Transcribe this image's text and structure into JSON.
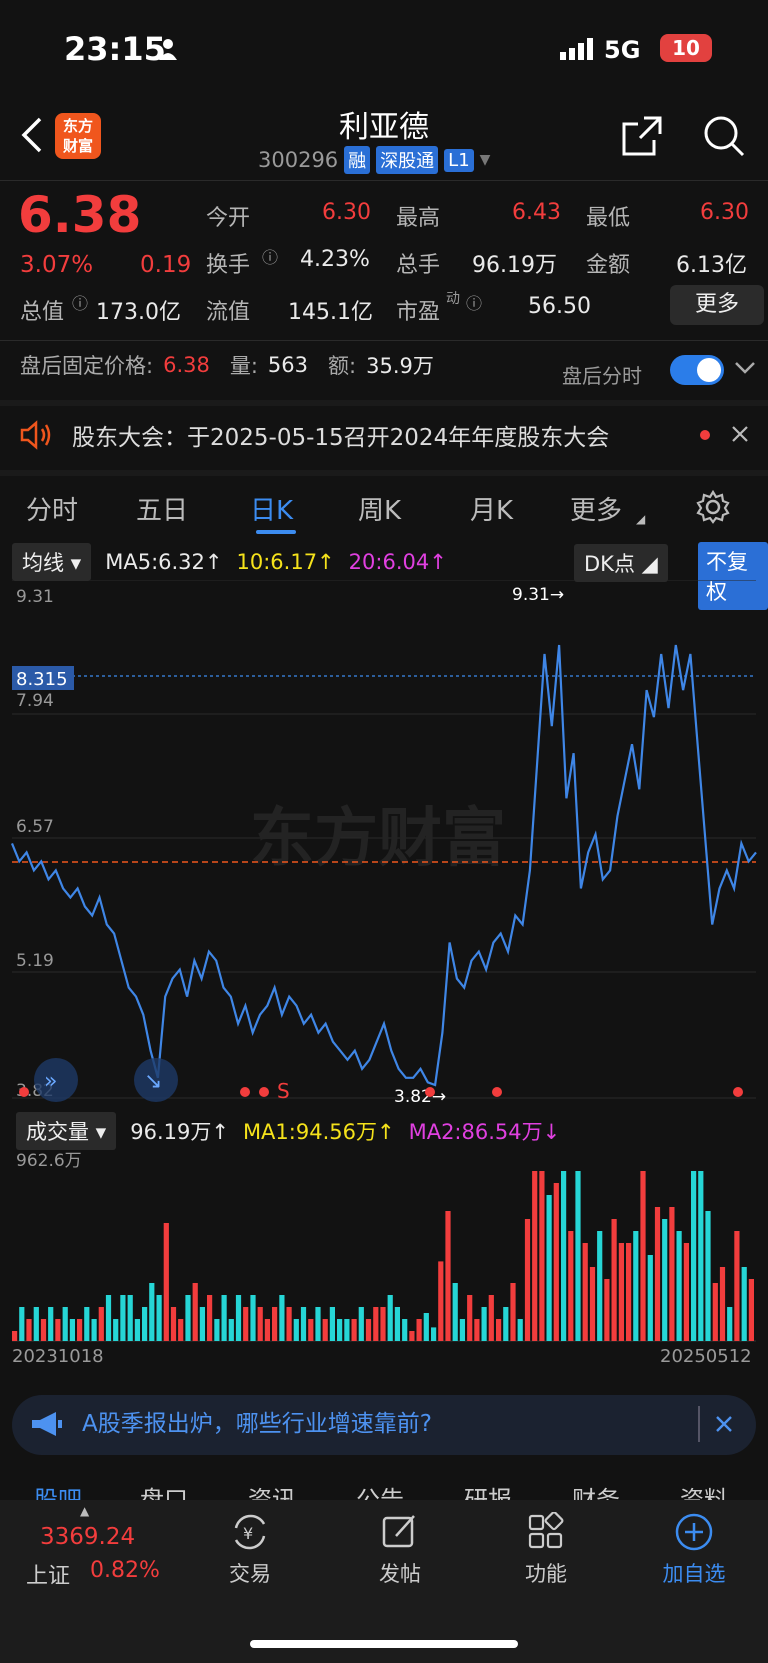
{
  "status_bar": {
    "time": "23:15",
    "network": "5G",
    "battery": "10"
  },
  "header": {
    "logo_line1": "东方",
    "logo_line2": "财富",
    "title": "利亚德",
    "code": "300296",
    "tags": [
      "融",
      "深股通",
      "L1"
    ]
  },
  "quote": {
    "price": "6.38",
    "change_pct": "3.07%",
    "change": "0.19",
    "open_label": "今开",
    "open": "6.30",
    "high_label": "最高",
    "high": "6.43",
    "low_label": "最低",
    "low": "6.30",
    "turnover_label": "换手",
    "turnover": "4.23%",
    "volume_label": "总手",
    "volume": "96.19万",
    "amount_label": "金额",
    "amount": "6.13亿",
    "mktcap_label": "总值",
    "mktcap": "173.0亿",
    "float_label": "流值",
    "float": "145.1亿",
    "pe_label": "市盈",
    "pe_sup": "动",
    "pe": "56.50",
    "more": "更多"
  },
  "afterhours": {
    "label": "盘后固定价格:",
    "price": "6.38",
    "vol_label": "量:",
    "vol": "563",
    "amt_label": "额:",
    "amt": "35.9万",
    "toggle_label": "盘后分时"
  },
  "notice": {
    "text": "股东大会：于2025-05-15召开2024年年度股东大会"
  },
  "tabs": [
    "分时",
    "五日",
    "日K",
    "周K",
    "月K",
    "更多"
  ],
  "active_tab": "日K",
  "chart": {
    "ma_select": "均线",
    "ma5": "MA5:6.32↑",
    "ma10": "10:6.17↑",
    "ma20": "20:6.04↑",
    "dk": "DK点",
    "adjust": "不复权",
    "y_labels": [
      "9.31",
      "7.94",
      "6.57",
      "5.19",
      "3.82"
    ],
    "crosshair_price": "8.315",
    "max_label": "9.31→",
    "min_label": "3.82→",
    "signal_label": "S",
    "watermark": "东方财富",
    "vol_select": "成交量",
    "vol_value": "96.19万↑",
    "vol_ma1": "MA1:94.56万↑",
    "vol_ma2": "MA2:86.54万↓",
    "vol_max": "962.6万",
    "date_start": "20231018",
    "date_end": "20250512"
  },
  "chart_data": {
    "type": "line",
    "ylim": [
      3.82,
      9.31
    ],
    "values": [
      6.5,
      6.3,
      6.4,
      6.2,
      6.3,
      6.1,
      6.2,
      6.0,
      5.9,
      6.0,
      5.8,
      5.7,
      5.9,
      5.6,
      5.5,
      5.2,
      4.9,
      4.8,
      4.6,
      4.2,
      3.9,
      4.8,
      5.0,
      5.1,
      4.8,
      5.2,
      5.0,
      5.3,
      5.2,
      4.9,
      4.8,
      4.5,
      4.7,
      4.4,
      4.6,
      4.7,
      4.9,
      4.6,
      4.8,
      4.7,
      4.5,
      4.6,
      4.4,
      4.5,
      4.3,
      4.2,
      4.1,
      4.2,
      4.0,
      4.1,
      4.3,
      4.5,
      4.2,
      4.0,
      3.9,
      3.9,
      4.0,
      3.85,
      3.82,
      4.4,
      5.4,
      5.0,
      4.9,
      5.2,
      5.3,
      5.1,
      5.4,
      5.5,
      5.3,
      5.7,
      5.6,
      6.2,
      7.4,
      8.6,
      7.8,
      8.7,
      7.0,
      7.5,
      6.0,
      6.4,
      6.6,
      6.1,
      6.2,
      6.8,
      7.2,
      7.6,
      7.1,
      8.2,
      7.9,
      8.6,
      8.0,
      8.7,
      8.2,
      8.6,
      7.6,
      6.6,
      5.6,
      6.0,
      6.2,
      6.0,
      6.5,
      6.3,
      6.4
    ],
    "volume_max": "962.6万"
  },
  "banner": {
    "text": "A股季报出炉，哪些行业增速靠前?"
  },
  "bottom_tabs_peek": [
    "股吧",
    "盘口",
    "资讯",
    "公告",
    "研报",
    "财务",
    "资料"
  ],
  "bottom_bar": {
    "index_value": "3369.24",
    "index_name": "上证",
    "index_pct": "0.82%",
    "items": [
      "交易",
      "发帖",
      "功能",
      "加自选"
    ]
  }
}
